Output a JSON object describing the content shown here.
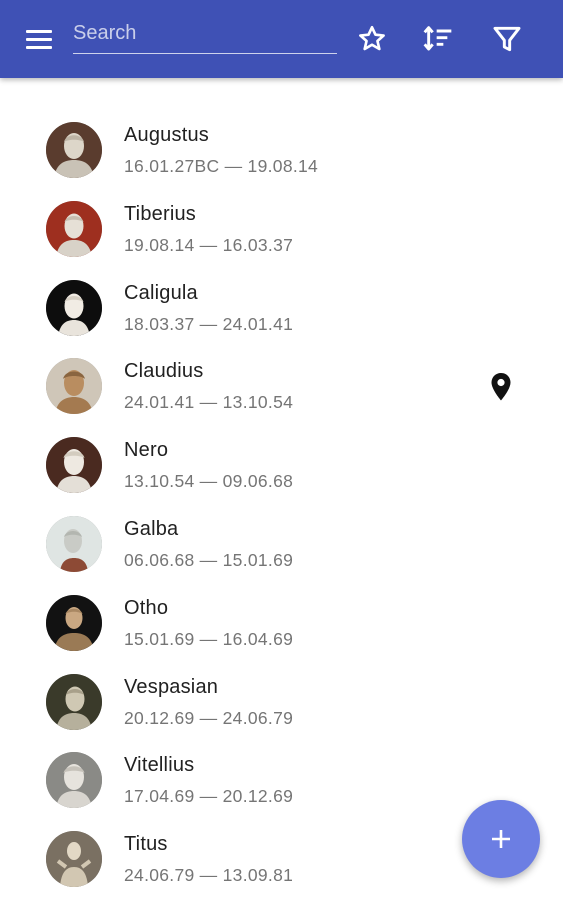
{
  "toolbar": {
    "search_placeholder": "Search",
    "background_color": "#3f51b5",
    "icons": {
      "menu": "menu-icon",
      "favorite": "star-outline-icon",
      "sort": "sort-icon",
      "filter": "filter-icon"
    }
  },
  "emperors": [
    {
      "name": "Augustus",
      "dates": "16.01.27BC — 19.08.14",
      "has_location": false
    },
    {
      "name": "Tiberius",
      "dates": "19.08.14 — 16.03.37",
      "has_location": false
    },
    {
      "name": "Caligula",
      "dates": "18.03.37 — 24.01.41",
      "has_location": false
    },
    {
      "name": "Claudius",
      "dates": "24.01.41 — 13.10.54",
      "has_location": true
    },
    {
      "name": "Nero",
      "dates": "13.10.54 — 09.06.68",
      "has_location": false
    },
    {
      "name": "Galba",
      "dates": "06.06.68 — 15.01.69",
      "has_location": false
    },
    {
      "name": "Otho",
      "dates": "15.01.69 — 16.04.69",
      "has_location": false
    },
    {
      "name": "Vespasian",
      "dates": "20.12.69 — 24.06.79",
      "has_location": false
    },
    {
      "name": "Vitellius",
      "dates": "17.04.69 — 20.12.69",
      "has_location": false
    },
    {
      "name": "Titus",
      "dates": "24.06.79 — 13.09.81",
      "has_location": false
    }
  ],
  "fab": {
    "icon": "add-icon",
    "color": "#6c7ee3"
  }
}
